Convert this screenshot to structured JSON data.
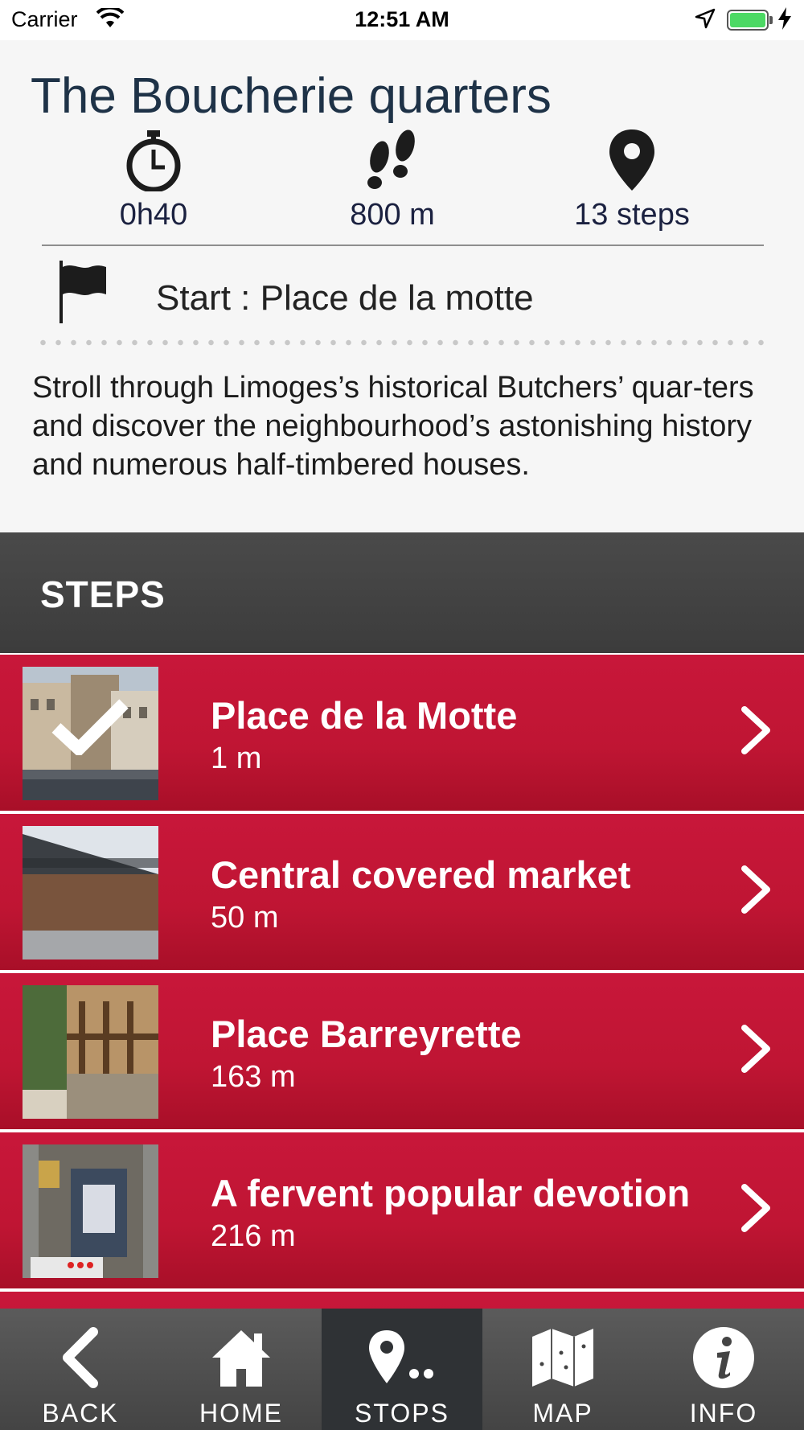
{
  "status_bar": {
    "carrier": "Carrier",
    "time": "12:51 AM"
  },
  "tour": {
    "title": "The Boucherie quarters",
    "stats": {
      "duration": "0h40",
      "distance": "800 m",
      "steps": "13 steps"
    },
    "start": "Start : Place de la motte",
    "description": "Stroll through Limoges’s historical Butchers’ quar-ters and discover the neighbourhood’s astonishing history and numerous half-timbered houses."
  },
  "steps_section": {
    "title": "STEPS",
    "items": [
      {
        "name": "Place de la Motte",
        "distance": "1 m",
        "visited": true
      },
      {
        "name": "Central covered market",
        "distance": "50 m",
        "visited": false
      },
      {
        "name": "Place Barreyrette",
        "distance": "163 m",
        "visited": false
      },
      {
        "name": "A fervent popular devotion",
        "distance": "216 m",
        "visited": false
      }
    ]
  },
  "tab_bar": {
    "back": "BACK",
    "home": "HOME",
    "stops": "STOPS",
    "map": "MAP",
    "info": "INFO",
    "active": "stops"
  },
  "colors": {
    "accent_red": "#c1163a",
    "title_navy": "#1e3247",
    "steps_header": "#444444",
    "tab_bar": "#4f4f4f"
  },
  "icons": [
    "wifi-icon",
    "location-arrow-icon",
    "battery-icon",
    "stopwatch-icon",
    "footsteps-icon",
    "map-pin-icon",
    "flag-icon",
    "checkmark-icon",
    "chevron-right-icon",
    "back-arrow-icon",
    "home-icon",
    "stops-icon",
    "map-icon",
    "info-icon"
  ]
}
